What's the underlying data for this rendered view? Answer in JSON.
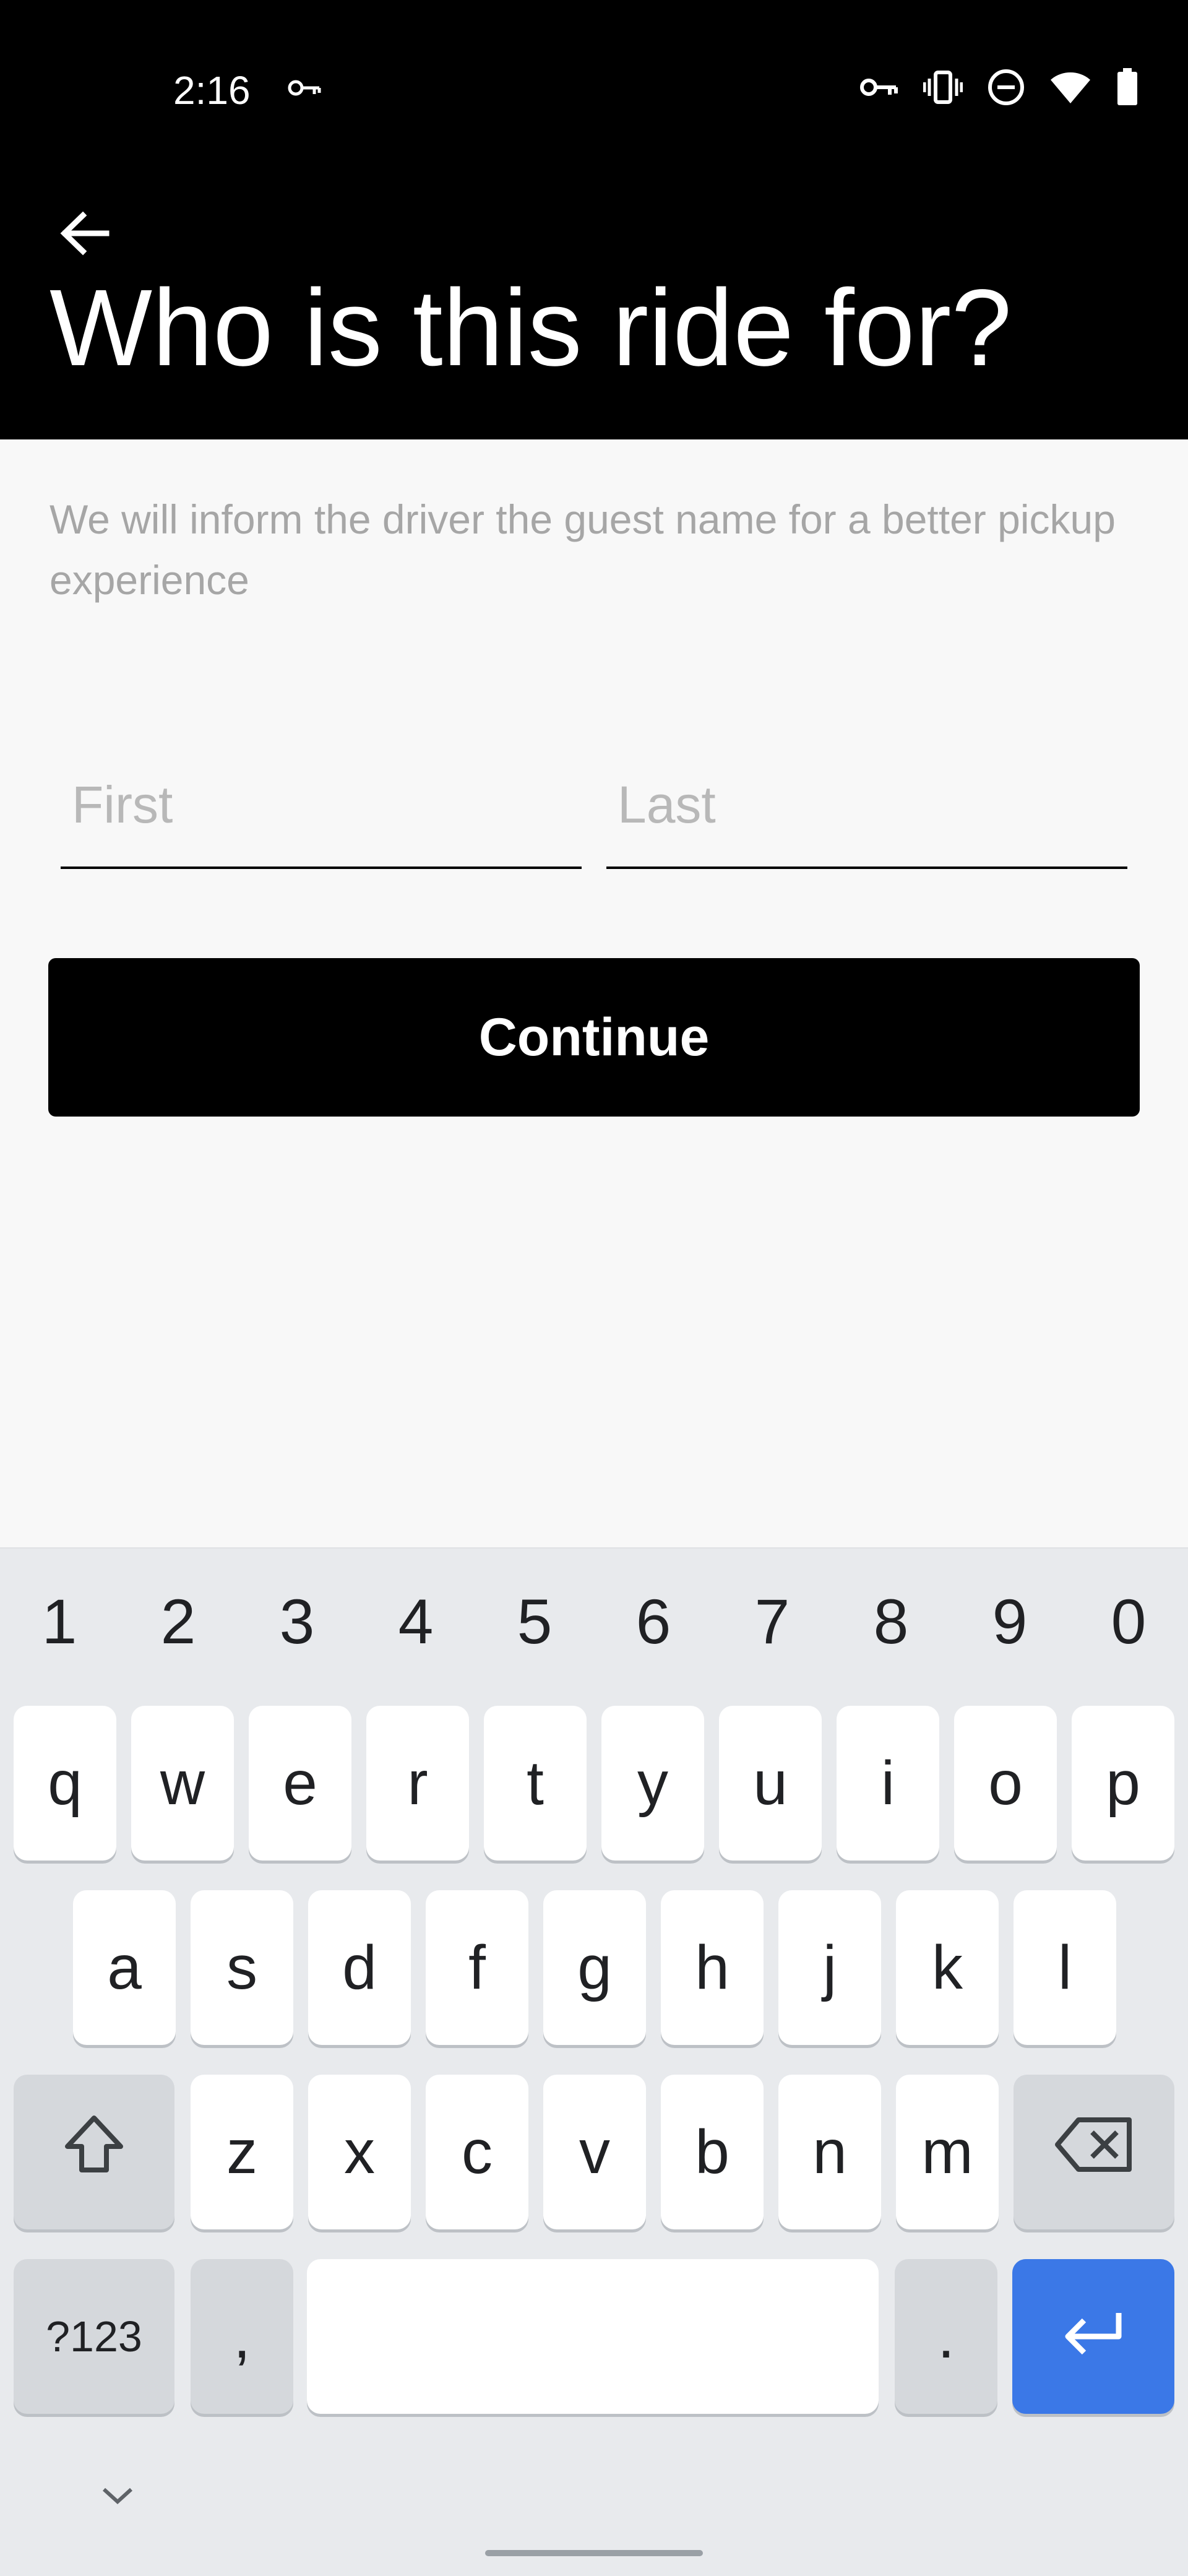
{
  "status_bar": {
    "time": "2:16",
    "left_icons": [
      "vpn-key-icon"
    ],
    "right_icons": [
      "vpn-key-icon",
      "vibrate-icon",
      "do-not-disturb-icon",
      "wifi-icon",
      "battery-icon"
    ]
  },
  "header": {
    "back_icon": "arrow-left-icon",
    "title": "Who is this ride for?"
  },
  "subtitle": "We will inform the driver the guest name for a better pickup experience",
  "form": {
    "first_placeholder": "First",
    "last_placeholder": "Last",
    "first_value": "",
    "last_value": ""
  },
  "continue_label": "Continue",
  "keyboard": {
    "number_row": [
      "1",
      "2",
      "3",
      "4",
      "5",
      "6",
      "7",
      "8",
      "9",
      "0"
    ],
    "row1": [
      "q",
      "w",
      "e",
      "r",
      "t",
      "y",
      "u",
      "i",
      "o",
      "p"
    ],
    "row2": [
      "a",
      "s",
      "d",
      "f",
      "g",
      "h",
      "j",
      "k",
      "l"
    ],
    "row3": [
      "z",
      "x",
      "c",
      "v",
      "b",
      "n",
      "m"
    ],
    "symbols_label": "?123",
    "comma_label": ",",
    "period_label": ".",
    "shift_icon": "shift-icon",
    "backspace_icon": "backspace-icon",
    "enter_icon": "enter-icon",
    "hide_icon": "chevron-down-icon"
  },
  "colors": {
    "header_bg": "#000000",
    "continue_bg": "#000000",
    "enter_key": "#3b78e7",
    "keyboard_bg": "#e8eaed"
  }
}
